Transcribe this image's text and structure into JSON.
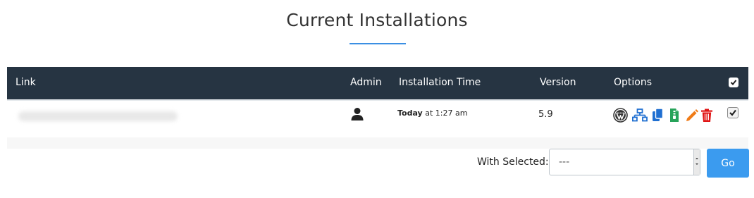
{
  "page": {
    "title": "Current Installations"
  },
  "table": {
    "headers": {
      "link": "Link",
      "admin": "Admin",
      "installation_time": "Installation Time",
      "version": "Version",
      "options": "Options"
    },
    "rows": [
      {
        "time_day": "Today",
        "time_rest": " at 1:27 am",
        "version": "5.9"
      }
    ]
  },
  "icons": {
    "admin": "user-icon",
    "options": [
      "wordpress-icon",
      "staging-network-icon",
      "clone-icon",
      "backup-file-icon",
      "edit-pencil-icon",
      "trash-icon"
    ]
  },
  "colors": {
    "header_bg": "#263442",
    "accent": "#3b8fe3",
    "options_blue": "#1f6fd1",
    "options_green": "#27a35a",
    "options_orange": "#f07b16",
    "options_red": "#e01515",
    "go_button": "#3b9bef"
  },
  "bulk": {
    "label": "With Selected:",
    "select_value": "---",
    "go_label": "Go"
  }
}
